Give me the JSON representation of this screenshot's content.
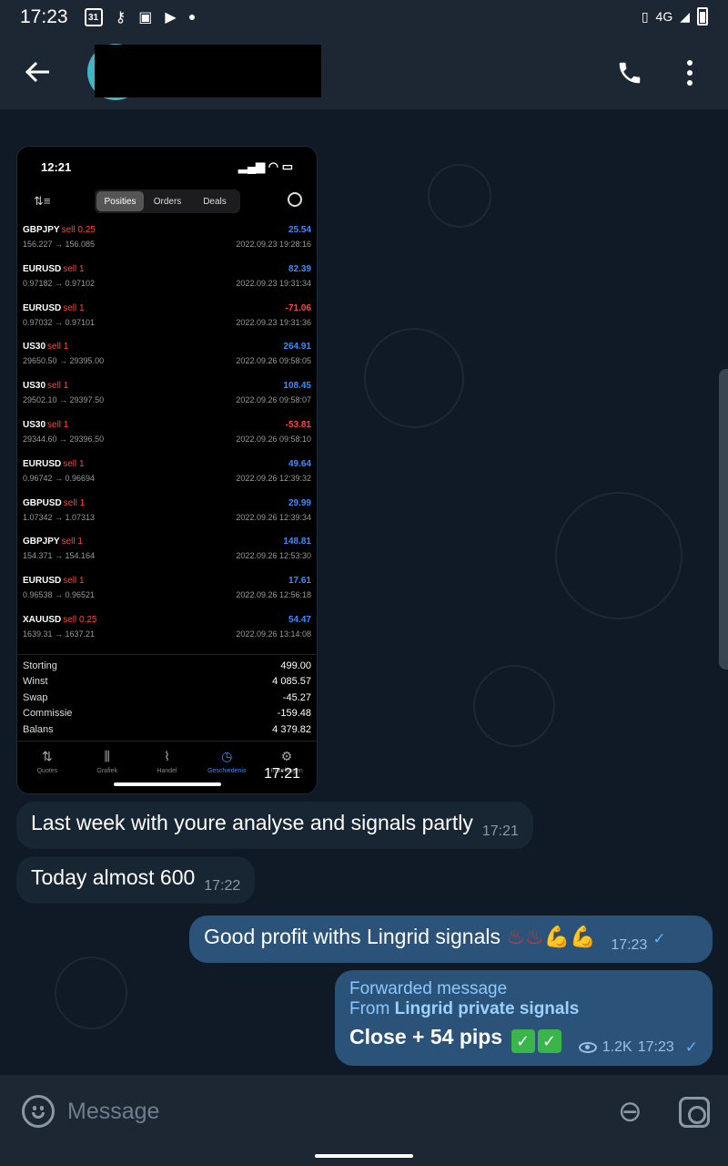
{
  "status_bar": {
    "time": "17:23",
    "calendar_day": "31",
    "network": "4G"
  },
  "header": {
    "back_icon": "arrow-left-icon",
    "call_icon": "phone-icon",
    "more_icon": "more-vertical-icon"
  },
  "photo_message": {
    "time": "17:21",
    "screenshot": {
      "status_time": "12:21",
      "tabs": [
        "Posities",
        "Orders",
        "Deals"
      ],
      "active_tab": "Posities",
      "rows": [
        {
          "symbol": "GBPJPY",
          "side": "sell 0.25",
          "prices": "156.227 → 156.085",
          "pnl": "25.54",
          "ts": "2022.09.23 19:28:16",
          "sign": "pos"
        },
        {
          "symbol": "EURUSD",
          "side": "sell 1",
          "prices": "0.97182 → 0.97102",
          "pnl": "82.39",
          "ts": "2022.09.23 19:31:34",
          "sign": "pos"
        },
        {
          "symbol": "EURUSD",
          "side": "sell 1",
          "prices": "0.97032 → 0.97101",
          "pnl": "-71.06",
          "ts": "2022.09.23 19:31:36",
          "sign": "neg"
        },
        {
          "symbol": "US30",
          "side": "sell 1",
          "prices": "29650.50 → 29395.00",
          "pnl": "264.91",
          "ts": "2022.09.26 09:58:05",
          "sign": "pos"
        },
        {
          "symbol": "US30",
          "side": "sell 1",
          "prices": "29502.10 → 29397.50",
          "pnl": "108.45",
          "ts": "2022.09.26 09:58:07",
          "sign": "pos"
        },
        {
          "symbol": "US30",
          "side": "sell 1",
          "prices": "29344.60 → 29396.50",
          "pnl": "-53.81",
          "ts": "2022.09.26 09:58:10",
          "sign": "neg"
        },
        {
          "symbol": "EURUSD",
          "side": "sell 1",
          "prices": "0.96742 → 0.96694",
          "pnl": "49.64",
          "ts": "2022.09.26 12:39:32",
          "sign": "pos"
        },
        {
          "symbol": "GBPUSD",
          "side": "sell 1",
          "prices": "1.07342 → 1.07313",
          "pnl": "29.99",
          "ts": "2022.09.26 12:39:34",
          "sign": "pos"
        },
        {
          "symbol": "GBPJPY",
          "side": "sell 1",
          "prices": "154.371 → 154.164",
          "pnl": "148.81",
          "ts": "2022.09.26 12:53:30",
          "sign": "pos"
        },
        {
          "symbol": "EURUSD",
          "side": "sell 1",
          "prices": "0.96538 → 0.96521",
          "pnl": "17.61",
          "ts": "2022.09.26 12:56:18",
          "sign": "pos"
        },
        {
          "symbol": "XAUUSD",
          "side": "sell 0.25",
          "prices": "1639.31 → 1637.21",
          "pnl": "54.47",
          "ts": "2022.09.26 13:14:08",
          "sign": "pos"
        }
      ],
      "summary": [
        {
          "label": "Storting",
          "value": "499.00"
        },
        {
          "label": "Winst",
          "value": "4 085.57"
        },
        {
          "label": "Swap",
          "value": "-45.27"
        },
        {
          "label": "Commissie",
          "value": "-159.48"
        },
        {
          "label": "Balans",
          "value": "4 379.82"
        }
      ],
      "nav": [
        {
          "label": "Quotes",
          "icon": "⇅"
        },
        {
          "label": "Grafiek",
          "icon": "⫼"
        },
        {
          "label": "Handel",
          "icon": "⌇"
        },
        {
          "label": "Geschiedenis",
          "icon": "◷"
        },
        {
          "label": "Instellingen",
          "icon": "⚙"
        }
      ],
      "active_nav": "Geschiedenis"
    }
  },
  "messages": [
    {
      "text": "Last week with youre analyse and signals partly",
      "time": "17:21"
    },
    {
      "text": "Today almost 600",
      "time": "17:22"
    },
    {
      "text": "Good profit withs Lingrid signals",
      "time": "17:23"
    }
  ],
  "forwarded": {
    "label": "Forwarded message",
    "from_prefix": "From",
    "from_name": "Lingrid private signals",
    "body": "Close + 54 pips",
    "views": "1.2K",
    "time": "17:23"
  },
  "composer": {
    "placeholder": "Message",
    "emoji_icon": "smile-icon",
    "attach_icon": "paperclip-icon",
    "camera_icon": "camera-icon"
  }
}
